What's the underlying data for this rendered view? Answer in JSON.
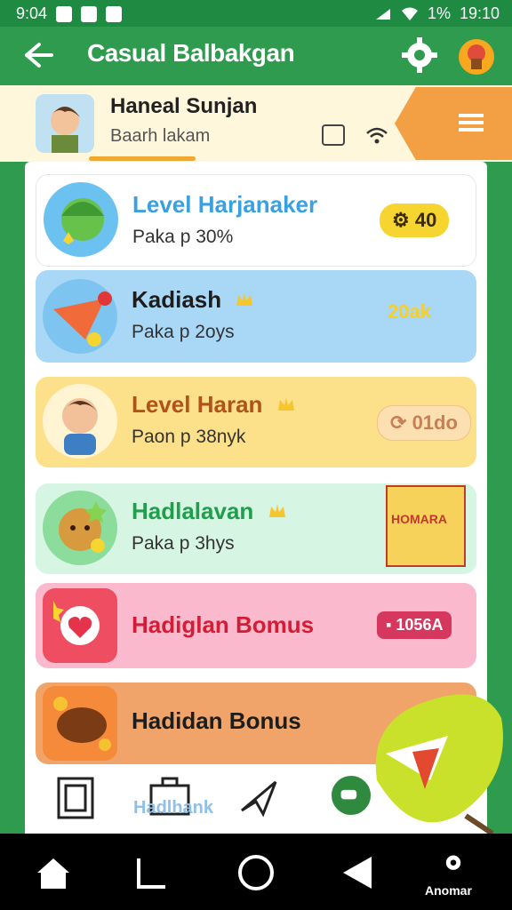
{
  "status_bar": {
    "time_left": "9:04",
    "battery": "1%",
    "time_right": "19:10"
  },
  "app_bar": {
    "title": "Casual Balbakgan",
    "back_icon": "arrow-left-icon",
    "settings_icon": "gear-icon",
    "avatar_icon": "profile-avatar-icon"
  },
  "profile": {
    "name": "Haneal Sunjan",
    "subtitle": "Baarh lakam",
    "menu_icon": "hamburger-icon"
  },
  "rows": [
    {
      "title": "Level Harjanaker",
      "subtitle": "Paka p 30%",
      "badge": "40",
      "colors": {
        "bg": "#ffffff",
        "title": "#3aa1e0",
        "badge_bg": "#f7d531",
        "badge_text": "#3a2b00"
      }
    },
    {
      "title": "Kadiash",
      "subtitle": "Paka p 2oys",
      "badge": "20ak",
      "colors": {
        "bg": "#a9d8f7",
        "title": "#1d1d1d",
        "badge_text": "#f5cf2b"
      }
    },
    {
      "title": "Level Haran",
      "subtitle": "Paon p 38nyk",
      "badge": "01do",
      "colors": {
        "bg": "#fde08a",
        "title": "#b0531b",
        "badge_bg": "#fde0b2",
        "badge_text": "#c77f56"
      }
    },
    {
      "title": "Hadlalavan",
      "subtitle": "Paka p 3hys",
      "badge": "HOMARA",
      "colors": {
        "bg": "#d6f5e3",
        "title": "#1f9f4e"
      }
    },
    {
      "title": "Hadiglan Bomus",
      "badge": "1056A",
      "colors": {
        "bg": "#fab9cd",
        "title": "#d31c35",
        "badge_bg": "#d6375f",
        "badge_text": "#ffffff"
      }
    },
    {
      "title": "Hadidan Bonus",
      "colors": {
        "bg": "#f0a46a",
        "title": "#1d1d1d"
      }
    }
  ],
  "bottom": {
    "label": "Hadlhank",
    "fab_icon": "gamepad-icon"
  },
  "nav": {
    "label": "Anomar"
  },
  "colors": {
    "primary_green": "#2f9b4f",
    "status_green": "#1f8a41"
  }
}
